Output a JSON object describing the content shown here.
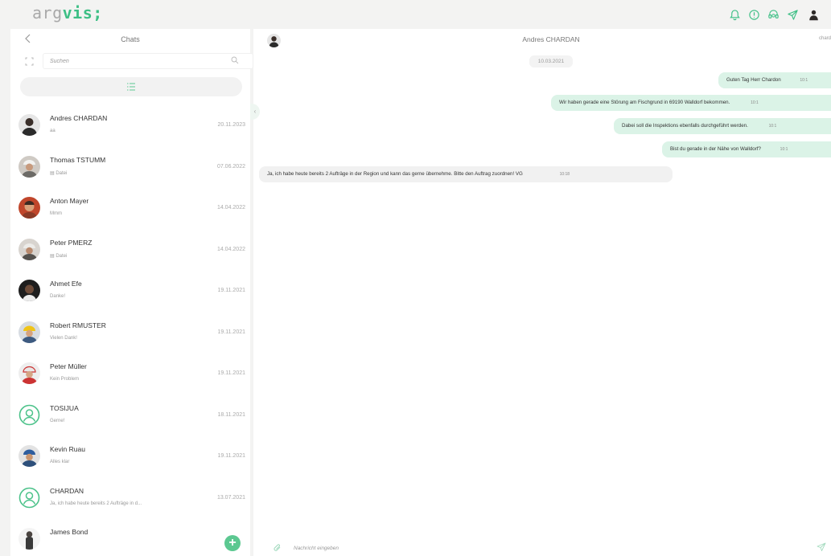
{
  "app": {
    "logo_prefix": "arg",
    "logo_suffix": "vis;"
  },
  "colors": {
    "accent": "#3dbf85",
    "outgoing_bubble": "#dbf3e7",
    "incoming_bubble": "#f1f1f1"
  },
  "header_icons": [
    "bell-icon",
    "info-icon",
    "support-icon",
    "send-icon",
    "user-avatar"
  ],
  "sidebar": {
    "title": "Chats",
    "search_placeholder": "Suchen",
    "chats": [
      {
        "name": "Andres CHARDAN",
        "preview": "aa",
        "date": "20.11.2023",
        "avatar": "dark-hair"
      },
      {
        "name": "Thomas TSTUMM",
        "preview": "Datei",
        "date": "07.06.2022",
        "avatar": "helmet"
      },
      {
        "name": "Anton Mayer",
        "preview": "Mmm",
        "date": "14.04.2022",
        "avatar": "red-bg"
      },
      {
        "name": "Peter PMERZ",
        "preview": "Datei",
        "date": "14.04.2022",
        "avatar": "helmet"
      },
      {
        "name": "Ahmet Efe",
        "preview": "Danke!",
        "date": "19.11.2021",
        "avatar": "dark-hair"
      },
      {
        "name": "Robert RMUSTER",
        "preview": "Vielen Dank!",
        "date": "19.11.2021",
        "avatar": "yellow-helmet"
      },
      {
        "name": "Peter Müller",
        "preview": "Kein Problem",
        "date": "19.11.2021",
        "avatar": "red-helmet"
      },
      {
        "name": "TOSIJUA",
        "preview": "Gerne!",
        "date": "18.11.2021",
        "avatar": "placeholder"
      },
      {
        "name": "Kevin Ruau",
        "preview": "Alles klar",
        "date": "19.11.2021",
        "avatar": "blue-helmet"
      },
      {
        "name": "CHARDAN",
        "preview": "Ja, ich habe heute bereits 2 Aufträge in d...",
        "date": "13.07.2021",
        "avatar": "placeholder"
      },
      {
        "name": "James Bond",
        "preview": "",
        "date": "",
        "avatar": "suit"
      }
    ],
    "add_label": "+"
  },
  "conversation": {
    "contact_name": "Andres CHARDAN",
    "current_user": "chard",
    "date_separator": "10.03.2021",
    "messages": [
      {
        "direction": "out",
        "text": "Guten Tag Herr Chardon",
        "time": "10:1"
      },
      {
        "direction": "out",
        "text": "Wir haben gerade eine Störung am Fischgrund in 69190 Walldorf bekommen.",
        "time": "10:1"
      },
      {
        "direction": "out",
        "text": "Dabei soll die Inspektions ebenfalls durchgeführt werden.",
        "time": "10:1"
      },
      {
        "direction": "out",
        "text": "Bist du gerade in der Nähe von Walldorf?",
        "time": "10:1"
      },
      {
        "direction": "in",
        "text": "Ja, ich habe heute bereits 2 Aufträge in der Region und kann das gerne übernehme. Bitte den Auftrag zuordnen! VG",
        "time": "10:18"
      }
    ],
    "composer_placeholder": "Nachricht eingeben"
  }
}
